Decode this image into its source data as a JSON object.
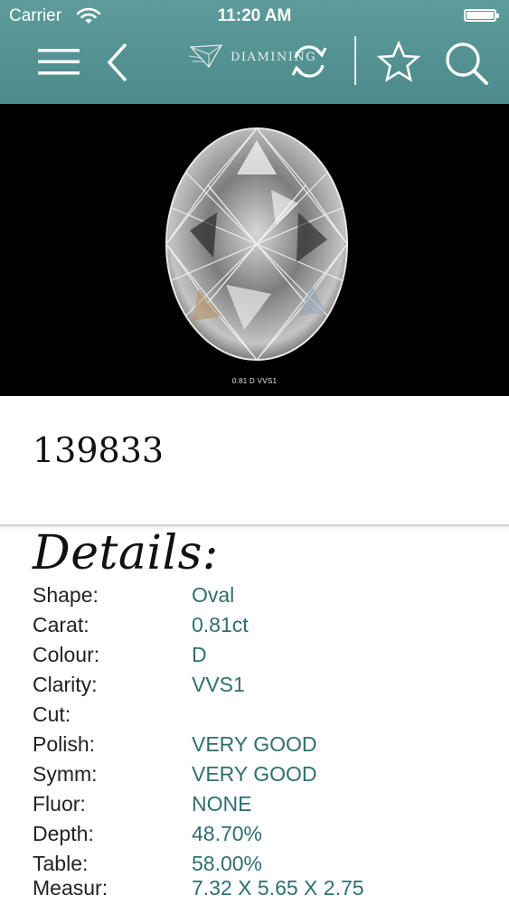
{
  "status_bar": {
    "carrier": "Carrier",
    "time": "11:20 AM"
  },
  "nav": {
    "logo_text": "DIAMINING",
    "icons": [
      "menu-icon",
      "back-chevron-icon",
      "refresh-icon",
      "star-icon",
      "search-icon"
    ]
  },
  "photo": {
    "caption": "0.81 D VVS1"
  },
  "stone": {
    "stock_number": "139833"
  },
  "details": {
    "title": "Details:",
    "rows": [
      {
        "label": "Shape:",
        "value": "Oval"
      },
      {
        "label": "Carat:",
        "value": "0.81ct"
      },
      {
        "label": "Colour:",
        "value": "D"
      },
      {
        "label": "Clarity:",
        "value": "VVS1"
      },
      {
        "label": "Cut:",
        "value": ""
      },
      {
        "label": "Polish:",
        "value": "VERY GOOD"
      },
      {
        "label": "Symm:",
        "value": "VERY GOOD"
      },
      {
        "label": "Fluor:",
        "value": "NONE"
      },
      {
        "label": "Depth:",
        "value": "48.70%"
      },
      {
        "label": "Table:",
        "value": "58.00%"
      },
      {
        "label": "Measur:",
        "value": "7.32 X 5.65 X 2.75"
      }
    ]
  },
  "colors": {
    "header_teal": "#558f8f",
    "value_teal": "#2f6f6e"
  }
}
